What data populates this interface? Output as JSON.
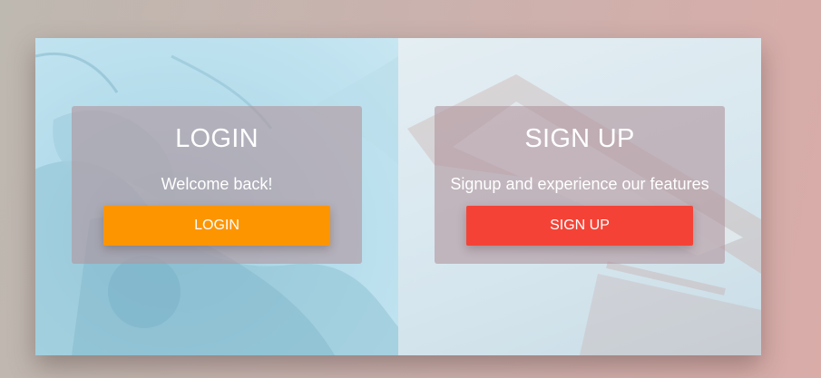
{
  "colors": {
    "login_button": "#fd9500",
    "signup_button": "#f44336",
    "card_text": "#ffffff"
  },
  "login": {
    "title": "LOGIN",
    "subtitle": "Welcome back!",
    "button_label": "LOGIN"
  },
  "signup": {
    "title": "SIGN UP",
    "subtitle": "Signup and experience our features",
    "button_label": "SIGN UP"
  }
}
